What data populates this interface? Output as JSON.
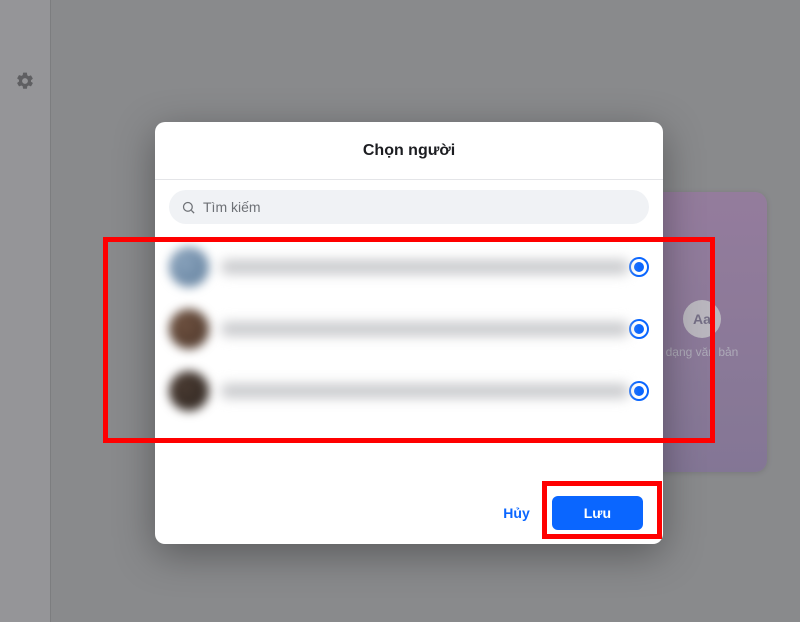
{
  "sidebar": {
    "gear_icon": "gear-icon"
  },
  "background_card": {
    "badge": "Aa",
    "label": "dạng văn bản"
  },
  "dialog": {
    "title": "Chọn người",
    "search": {
      "placeholder": "Tìm kiếm"
    },
    "people": [
      {
        "avatar_color1": "#5f7d9b",
        "avatar_color2": "#8aa3bc",
        "name_width": 110,
        "selected": true
      },
      {
        "avatar_color1": "#4a3529",
        "avatar_color2": "#6e5140",
        "name_width": 90,
        "selected": true
      },
      {
        "avatar_color1": "#2c241f",
        "avatar_color2": "#4a3b32",
        "name_width": 170,
        "selected": true
      }
    ],
    "footer": {
      "cancel_label": "Hủy",
      "save_label": "Lưu"
    }
  },
  "highlights": {
    "list": true,
    "save": true
  }
}
